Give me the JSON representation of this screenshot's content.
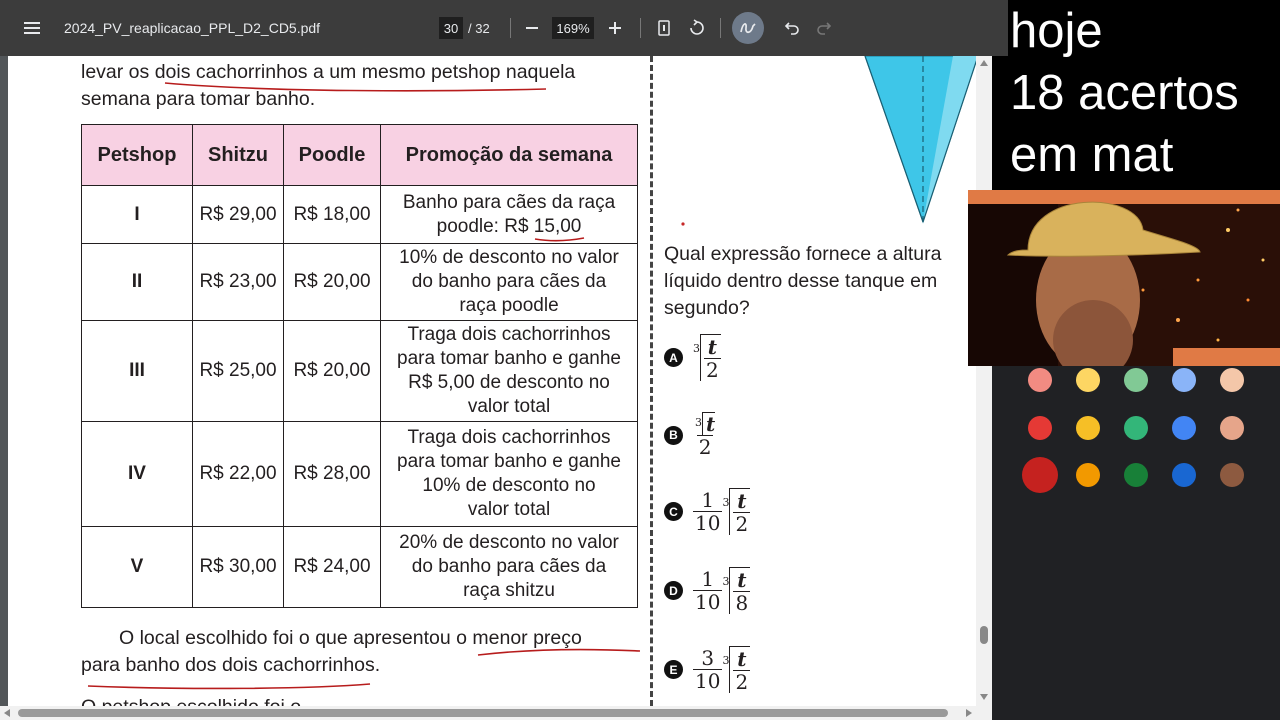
{
  "toolbar": {
    "filename": "2024_PV_reaplicacao_PPL_D2_CD5.pdf",
    "page_current": "30",
    "page_total": "/ 32",
    "zoom": "169%"
  },
  "overlay": {
    "line1": "hoje",
    "line2": "18 acertos",
    "line3": "em mat"
  },
  "left_page": {
    "intro_line1": "levar os dois cachorrinhos a um mesmo petshop naquela",
    "intro_line2": "semana para tomar banho.",
    "table": {
      "headers": [
        "Petshop",
        "Shitzu",
        "Poodle",
        "Promoção da semana"
      ],
      "rows": [
        {
          "id": "I",
          "shitzu": "R$ 29,00",
          "poodle": "R$ 18,00",
          "promo_lines": [
            "Banho para cães da raça",
            "poodle: R$ 15,00"
          ]
        },
        {
          "id": "II",
          "shitzu": "R$ 23,00",
          "poodle": "R$ 20,00",
          "promo_lines": [
            "10% de desconto no valor",
            "do banho para cães da",
            "raça poodle"
          ]
        },
        {
          "id": "III",
          "shitzu": "R$ 25,00",
          "poodle": "R$ 20,00",
          "promo_lines": [
            "Traga dois cachorrinhos",
            "para tomar banho e ganhe",
            "R$ 5,00 de desconto no",
            "valor total"
          ]
        },
        {
          "id": "IV",
          "shitzu": "R$ 22,00",
          "poodle": "R$ 28,00",
          "promo_lines": [
            "Traga dois cachorrinhos",
            "para tomar banho e ganhe",
            "10% de desconto no",
            "valor total"
          ]
        },
        {
          "id": "V",
          "shitzu": "R$ 30,00",
          "poodle": "R$ 24,00",
          "promo_lines": [
            "20% de desconto no valor",
            "do banho para cães da",
            "raça shitzu"
          ]
        }
      ]
    },
    "conclusion_line1": "O local escolhido foi o que apresentou o menor preço",
    "conclusion_line2": "para banho dos dois cachorrinhos.",
    "cutoff_line": "O petshop escolhido foi o"
  },
  "right_page": {
    "question_line1": "Qual expressão fornece a altura",
    "question_line2": "líquido dentro desse tanque em",
    "question_line3": "segundo?",
    "options": [
      {
        "letter": "A",
        "expr": "∛(t/2)"
      },
      {
        "letter": "B",
        "expr": "∛t / 2"
      },
      {
        "letter": "C",
        "expr": "(1/10)·∛(t/2)"
      },
      {
        "letter": "D",
        "expr": "(1/10)·∛(t/8)"
      },
      {
        "letter": "E",
        "expr": "(3/10)·∛(t/2)"
      }
    ],
    "math_parts": {
      "idx": "3",
      "t": "t",
      "two": "2",
      "eight": "8",
      "one": "1",
      "three": "3",
      "ten": "10"
    }
  },
  "palette": {
    "colors": [
      [
        "#f28b82",
        "#fdd663",
        "#81c995",
        "#8ab4f8",
        "#f4c7a9"
      ],
      [
        "#e53935",
        "#f6bf26",
        "#33b679",
        "#4285f4",
        "#e6a58a"
      ],
      [
        "#c5221f",
        "#f29900",
        "#188038",
        "#1967d2",
        "#8d5a40"
      ]
    ]
  }
}
